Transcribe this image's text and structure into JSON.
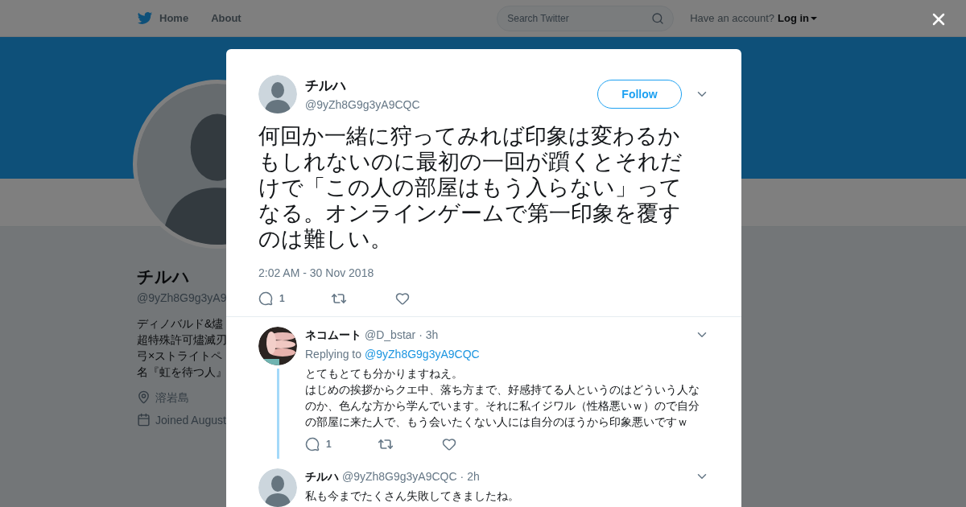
{
  "header": {
    "nav": [
      {
        "label": "Home"
      },
      {
        "label": "About"
      }
    ],
    "search": {
      "placeholder": "Search Twitter"
    },
    "account_prompt": "Have an account?",
    "login": "Log in"
  },
  "profile": {
    "name": "チルハ",
    "handle": "@9yZh8G9g3yA9",
    "bio": [
      "ディノバルド&燼",
      "超特殊許可燼滅刃",
      "弓×ストライトペ",
      "名『虹を待つ人』"
    ],
    "location": "溶岩島",
    "joined": "Joined August"
  },
  "tweet": {
    "name": "チルハ",
    "handle": "@9yZh8G9g3yA9CQC",
    "follow": "Follow",
    "text": "何回か一緒に狩ってみれば印象は変わるかもしれないのに最初の一回が躓くとそれだけで「この人の部屋はもう入らない」ってなる。オンラインゲームで第一印象を覆すのは難しい。",
    "timestamp": "2:02 AM - 30 Nov 2018",
    "reply_count": "1"
  },
  "replies": [
    {
      "kind": "picture",
      "name": "ネコムート",
      "handle": "@D_bstar",
      "time": "· 3h",
      "replying_label": "Replying to",
      "replying_to": "@9yZh8G9g3yA9CQC",
      "text": [
        "とてもとても分かりますねえ。",
        "はじめの挨拶からクエ中、落ち方まで、好感持てる人というのはどういう人なのか、色んな方から学んでいます。それに私イジワル（性格悪いｗ）ので自分の部屋に来た人で、もう会いたくない人には自分のほうから印象悪いですｗ"
      ],
      "reply_count": "1"
    },
    {
      "kind": "default",
      "name": "チルハ",
      "handle": "@9yZh8G9g3yA9CQC",
      "time": "· 2h",
      "text": [
        "私も今までたくさん失敗してきましたね。"
      ]
    }
  ]
}
